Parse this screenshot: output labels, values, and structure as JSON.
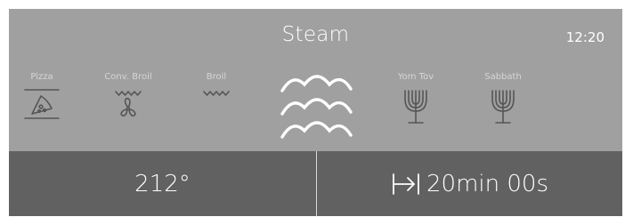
{
  "header": {
    "title": "Steam",
    "clock": "12:20"
  },
  "modes": [
    {
      "label": "Pizza",
      "icon": "pizza-icon"
    },
    {
      "label": "Conv. Broil",
      "icon": "fan-broil-icon"
    },
    {
      "label": "Broil",
      "icon": "broil-wave-icon"
    },
    {
      "label": "",
      "icon": "steam-icon",
      "selected": true
    },
    {
      "label": "Yom Tov",
      "icon": "menorah-icon"
    },
    {
      "label": "Sabbath",
      "icon": "menorah-icon"
    }
  ],
  "bottom": {
    "temperature": "212°",
    "timer_icon": "timer-arrow-icon",
    "timer": "20min 00s"
  },
  "colors": {
    "panel": "#a0a0a0",
    "bottom_bar": "#616161",
    "icon": "#555555",
    "text": "#ffffff",
    "label": "#d6d6d6"
  }
}
